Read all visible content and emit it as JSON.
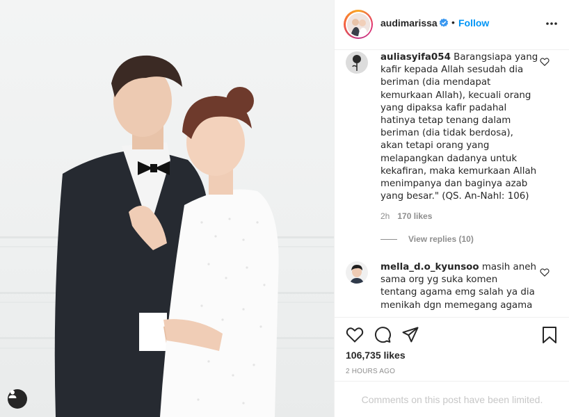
{
  "post": {
    "username": "audimarissa",
    "follow_label": "Follow",
    "separator": "•"
  },
  "comments": [
    {
      "username": "auliasyifa054",
      "lines": [
        "Barangsiapa yang",
        "kafir kepada Allah sesudah dia",
        "beriman (dia mendapat",
        "kemurkaan Allah), kecuali orang",
        "yang dipaksa kafir padahal",
        "hatinya tetap tenang dalam",
        "beriman (dia tidak berdosa),",
        "akan tetapi orang yang",
        "melapangkan dadanya untuk",
        "kekafiran, maka kemurkaan Allah",
        "menimpanya dan baginya azab",
        "yang besar.\" (QS. An-Nahl: 106)"
      ],
      "time": "2h",
      "likes": "170 likes",
      "view_replies": "View replies (10)"
    },
    {
      "username": "mella_d.o_kyunsoo",
      "lines": [
        "masih aneh",
        "sama org yg suka komen",
        "tentang agama emg salah ya dia",
        "menikah dgn memegang agama"
      ]
    }
  ],
  "actions": {
    "likes_count": "106,735 likes",
    "time_ago": "2 HOURS AGO",
    "comments_limited": "Comments on this post have been limited."
  },
  "icons": {
    "verified": "verified-badge-icon",
    "more": "more-options-icon",
    "like": "heart-icon",
    "comment": "comment-icon",
    "share": "paper-plane-icon",
    "save": "bookmark-icon",
    "tag": "user-tag-icon"
  },
  "colors": {
    "accent": "#0095f6",
    "text": "#262626",
    "muted": "#8e8e8e",
    "divider": "#efefef",
    "placeholder": "#c7c7c7"
  }
}
